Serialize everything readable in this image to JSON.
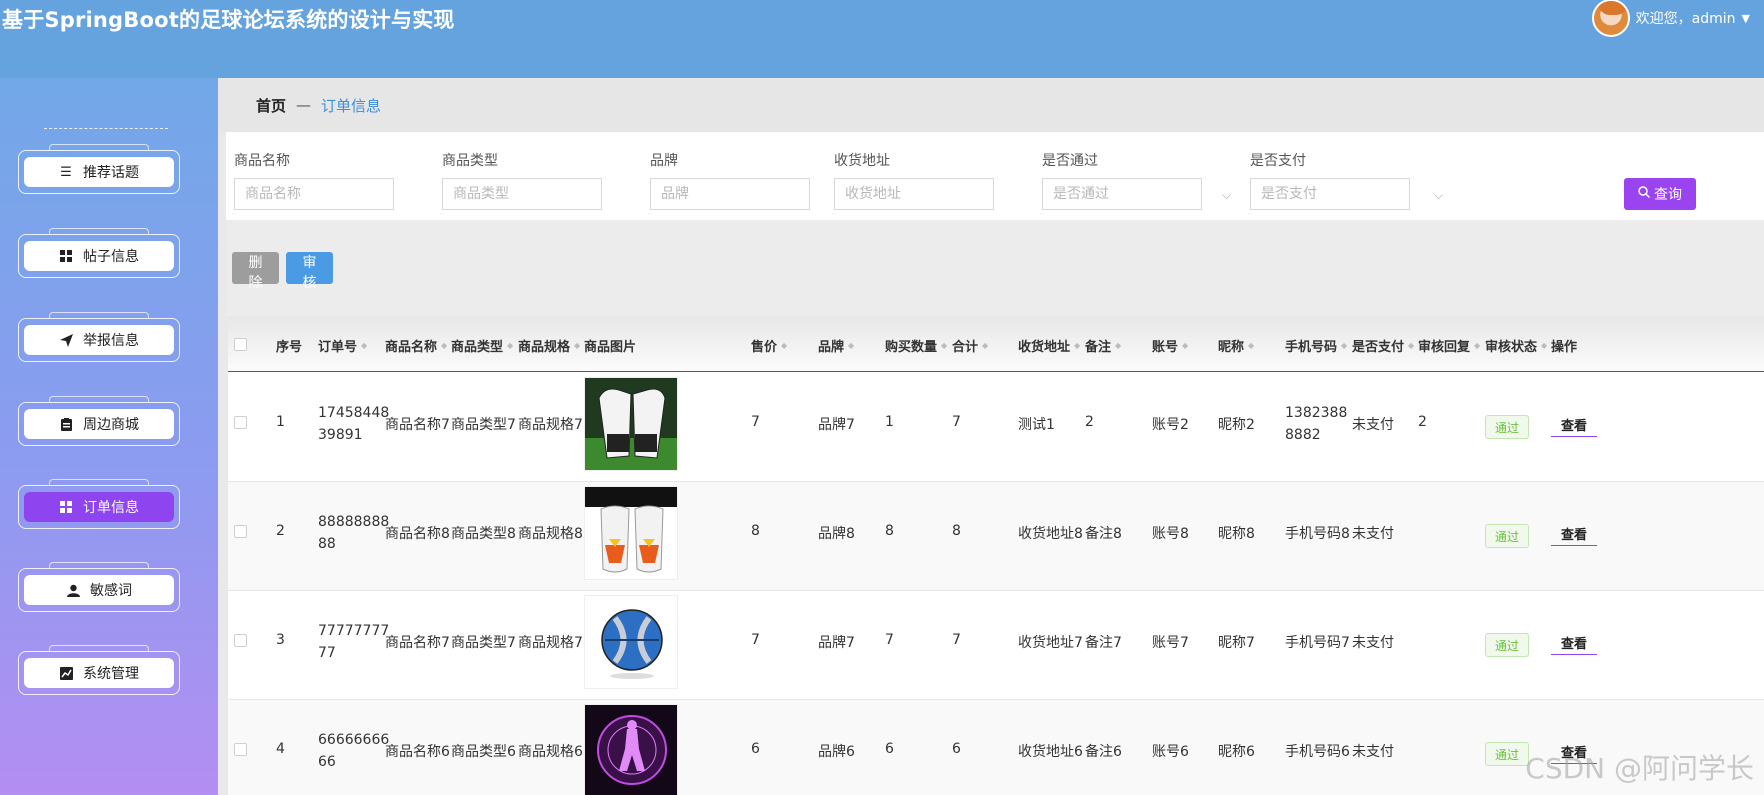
{
  "header": {
    "title": "基于SpringBoot的足球论坛系统的设计与实现",
    "welcome": "欢迎您，admin",
    "dropdown_icon": "caret-down-icon"
  },
  "sidebar": {
    "items": [
      {
        "label": "推荐话题",
        "icon": "list-icon",
        "active": false
      },
      {
        "label": "帖子信息",
        "icon": "grid-icon",
        "active": false
      },
      {
        "label": "举报信息",
        "icon": "send-icon",
        "active": false
      },
      {
        "label": "周边商城",
        "icon": "clipboard-icon",
        "active": false
      },
      {
        "label": "订单信息",
        "icon": "grid-icon",
        "active": true
      },
      {
        "label": "敏感词",
        "icon": "user-icon",
        "active": false
      },
      {
        "label": "系统管理",
        "icon": "chart-icon",
        "active": false
      }
    ]
  },
  "breadcrumb": {
    "home": "首页",
    "separator": "—",
    "current": "订单信息"
  },
  "search": {
    "fields": [
      {
        "label": "商品名称",
        "placeholder": "商品名称"
      },
      {
        "label": "商品类型",
        "placeholder": "商品类型"
      },
      {
        "label": "品牌",
        "placeholder": "品牌"
      },
      {
        "label": "收货地址",
        "placeholder": "收货地址"
      },
      {
        "label": "是否通过",
        "placeholder": "是否通过"
      },
      {
        "label": "是否支付",
        "placeholder": "是否支付"
      }
    ],
    "button_label": "查询"
  },
  "actions": {
    "delete_label": "删除",
    "audit_label": "审核"
  },
  "table": {
    "columns": [
      "序号",
      "订单号",
      "商品名称",
      "商品类型",
      "商品规格",
      "商品图片",
      "售价",
      "品牌",
      "购买数量",
      "合计",
      "收货地址",
      "备注",
      "账号",
      "昵称",
      "手机号码",
      "是否支付",
      "审核回复",
      "审核状态",
      "操作"
    ],
    "rows": [
      {
        "index": "1",
        "order_no": "1745844839891",
        "name": "商品名称7",
        "type": "商品类型7",
        "spec": "商品规格7",
        "image": "gloves",
        "price": "7",
        "brand": "品牌7",
        "qty": "1",
        "total": "7",
        "address": "测试1",
        "remark": "2",
        "account": "账号2",
        "nickname": "昵称2",
        "phone": "13823888882",
        "paid": "未支付",
        "reply": "2",
        "status": "通过",
        "op": "查看"
      },
      {
        "index": "2",
        "order_no": "8888888888",
        "name": "商品名称8",
        "type": "商品类型8",
        "spec": "商品规格8",
        "image": "shin-guard",
        "price": "8",
        "brand": "品牌8",
        "qty": "8",
        "total": "8",
        "address": "收货地址8",
        "remark": "备注8",
        "account": "账号8",
        "nickname": "昵称8",
        "phone": "手机号码8",
        "paid": "未支付",
        "reply": "",
        "status": "通过",
        "op": "查看"
      },
      {
        "index": "3",
        "order_no": "7777777777",
        "name": "商品名称7",
        "type": "商品类型7",
        "spec": "商品规格7",
        "image": "ball",
        "price": "7",
        "brand": "品牌7",
        "qty": "7",
        "total": "7",
        "address": "收货地址7",
        "remark": "备注7",
        "account": "账号7",
        "nickname": "昵称7",
        "phone": "手机号码7",
        "paid": "未支付",
        "reply": "",
        "status": "通过",
        "op": "查看"
      },
      {
        "index": "4",
        "order_no": "6666666666",
        "name": "商品名称6",
        "type": "商品类型6",
        "spec": "商品规格6",
        "image": "crystal",
        "price": "6",
        "brand": "品牌6",
        "qty": "6",
        "total": "6",
        "address": "收货地址6",
        "remark": "备注6",
        "account": "账号6",
        "nickname": "昵称6",
        "phone": "手机号码6",
        "paid": "未支付",
        "reply": "",
        "status": "通过",
        "op": "查看"
      }
    ]
  },
  "watermark": "CSDN @阿问学长",
  "colors": {
    "header": "#64a3de",
    "accent": "#9a44f0",
    "link": "#3b8ee0",
    "success": "#67c23a"
  }
}
